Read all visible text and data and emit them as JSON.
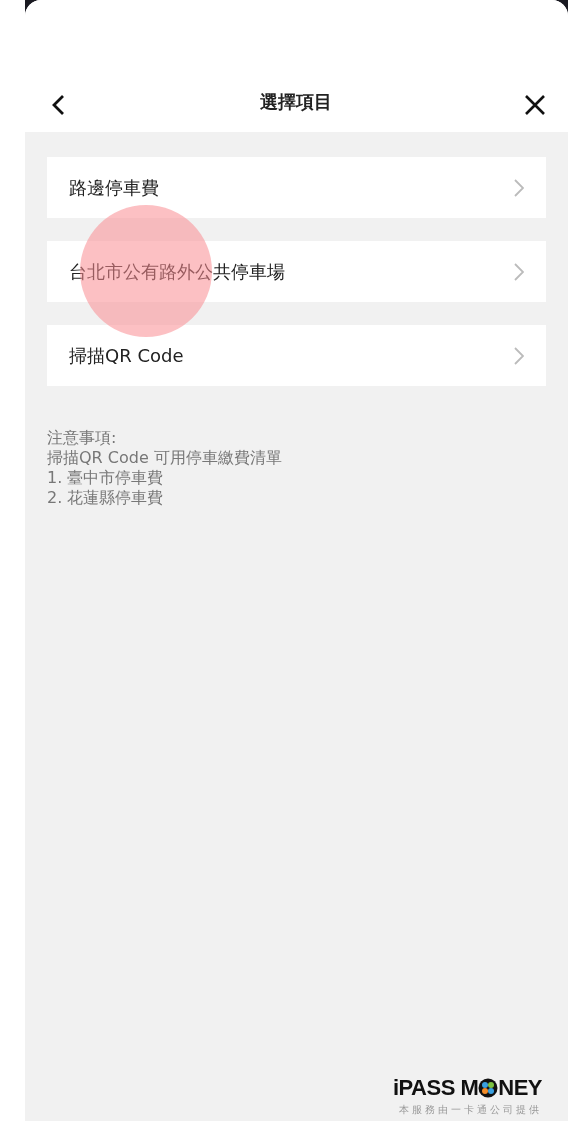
{
  "header": {
    "title": "選擇項目"
  },
  "items": [
    {
      "label": "路邊停車費",
      "touched": false
    },
    {
      "label": "台北市公有路外公共停車場",
      "touched": true
    },
    {
      "label": "掃描QR Code",
      "touched": false
    }
  ],
  "notes": [
    "注意事項:",
    "掃描QR Code 可用停車繳費清單",
    "1. 臺中市停車費",
    "2. 花蓮縣停車費"
  ],
  "footer": {
    "logo_before": "iPASS M",
    "logo_after": "NEY",
    "tagline": "本服務由一卡通公司提供"
  }
}
